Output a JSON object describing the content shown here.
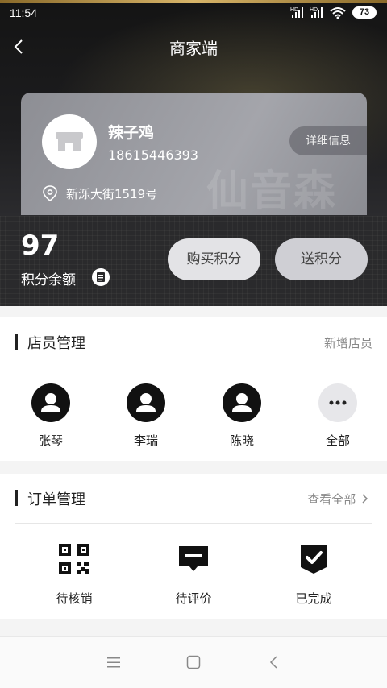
{
  "status_bar": {
    "time": "11:54",
    "battery": "73",
    "signal1_label": "HD",
    "signal2_label": "HD"
  },
  "header": {
    "title": "商家端"
  },
  "shop": {
    "name": "辣子鸡",
    "phone": "18615446393",
    "address": "新泺大街1519号",
    "detail_button": "详细信息",
    "watermark": "仙音森"
  },
  "points": {
    "value": "97",
    "label": "积分余额",
    "buy_button": "购买积分",
    "send_button": "送积分"
  },
  "staff_section": {
    "title": "店员管理",
    "add_link": "新增店员",
    "members": [
      {
        "name": "张琴",
        "icon": "person-icon"
      },
      {
        "name": "李瑞",
        "icon": "person-icon"
      },
      {
        "name": "陈晓",
        "icon": "person-icon"
      },
      {
        "name": "全部",
        "icon": "more-icon"
      }
    ]
  },
  "order_section": {
    "title": "订单管理",
    "view_all": "查看全部",
    "items": [
      {
        "label": "待核销",
        "icon": "qr-code-icon"
      },
      {
        "label": "待评价",
        "icon": "comment-icon"
      },
      {
        "label": "已完成",
        "icon": "badge-check-icon"
      }
    ]
  },
  "system_nav": {
    "icons": [
      "menu-icon",
      "home-square-icon",
      "back-icon"
    ]
  }
}
